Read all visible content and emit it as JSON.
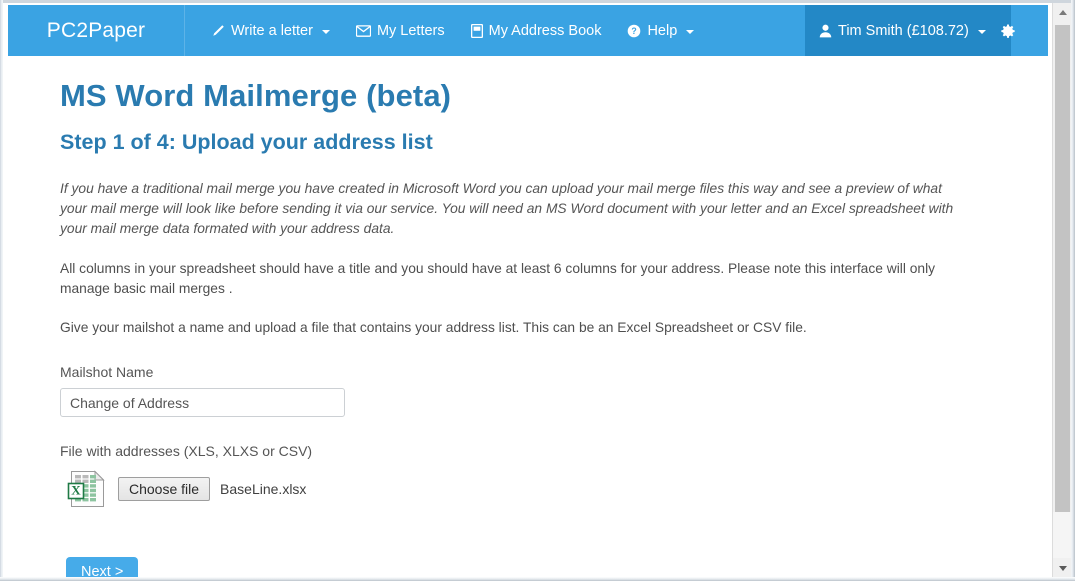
{
  "navbar": {
    "brand": "PC2Paper",
    "items": [
      {
        "label": "Write a letter",
        "icon": "pencil-icon",
        "caret": true
      },
      {
        "label": "My Letters",
        "icon": "envelope-icon",
        "caret": false
      },
      {
        "label": "My Address Book",
        "icon": "book-icon",
        "caret": false
      },
      {
        "label": "Help",
        "icon": "question-circle-icon",
        "caret": true
      }
    ],
    "user": {
      "label": "Tim Smith (£108.72)",
      "icon": "user-icon",
      "caret": true,
      "settings_icon": "gear-icon"
    },
    "colors": {
      "bar": "#3aa3e3",
      "user_block": "#2388c6",
      "text": "#ffffff"
    }
  },
  "page": {
    "title": "MS Word Mailmerge (beta)",
    "subtitle": "Step 1 of 4: Upload your address list",
    "heading_color": "#2a7bb0",
    "intro_paragraph": "If you have a traditional mail merge you have created in Microsoft Word you can upload your mail merge files this way and see a preview of what your mail merge will look like before sending it via our service. You will need an MS Word document with your letter and an Excel spreadsheet with your mail merge data formated with your address data.",
    "paragraph_2": "All columns in your spreadsheet should have a title and you should have at least 6 columns for your address. Please note this interface will only manage basic mail merges .",
    "paragraph_3": "Give your mailshot a name and upload a file that contains your address list. This can be an Excel Spreadsheet or CSV file."
  },
  "form": {
    "mailshot_name_label": "Mailshot Name",
    "mailshot_name_value": "Change of Address",
    "mailshot_name_placeholder": "Mailshot Name",
    "file_label": "File with addresses (XLS, XLXS or CSV)",
    "file_icon": "excel-file-icon",
    "choose_file_button": "Choose file",
    "selected_file_name": "BaseLine.xlsx",
    "next_button": "Next >",
    "next_button_color": "#46abe9"
  },
  "scrollbar": {
    "up_arrow": "scroll-up-arrow",
    "down_arrow": "scroll-down-arrow"
  }
}
